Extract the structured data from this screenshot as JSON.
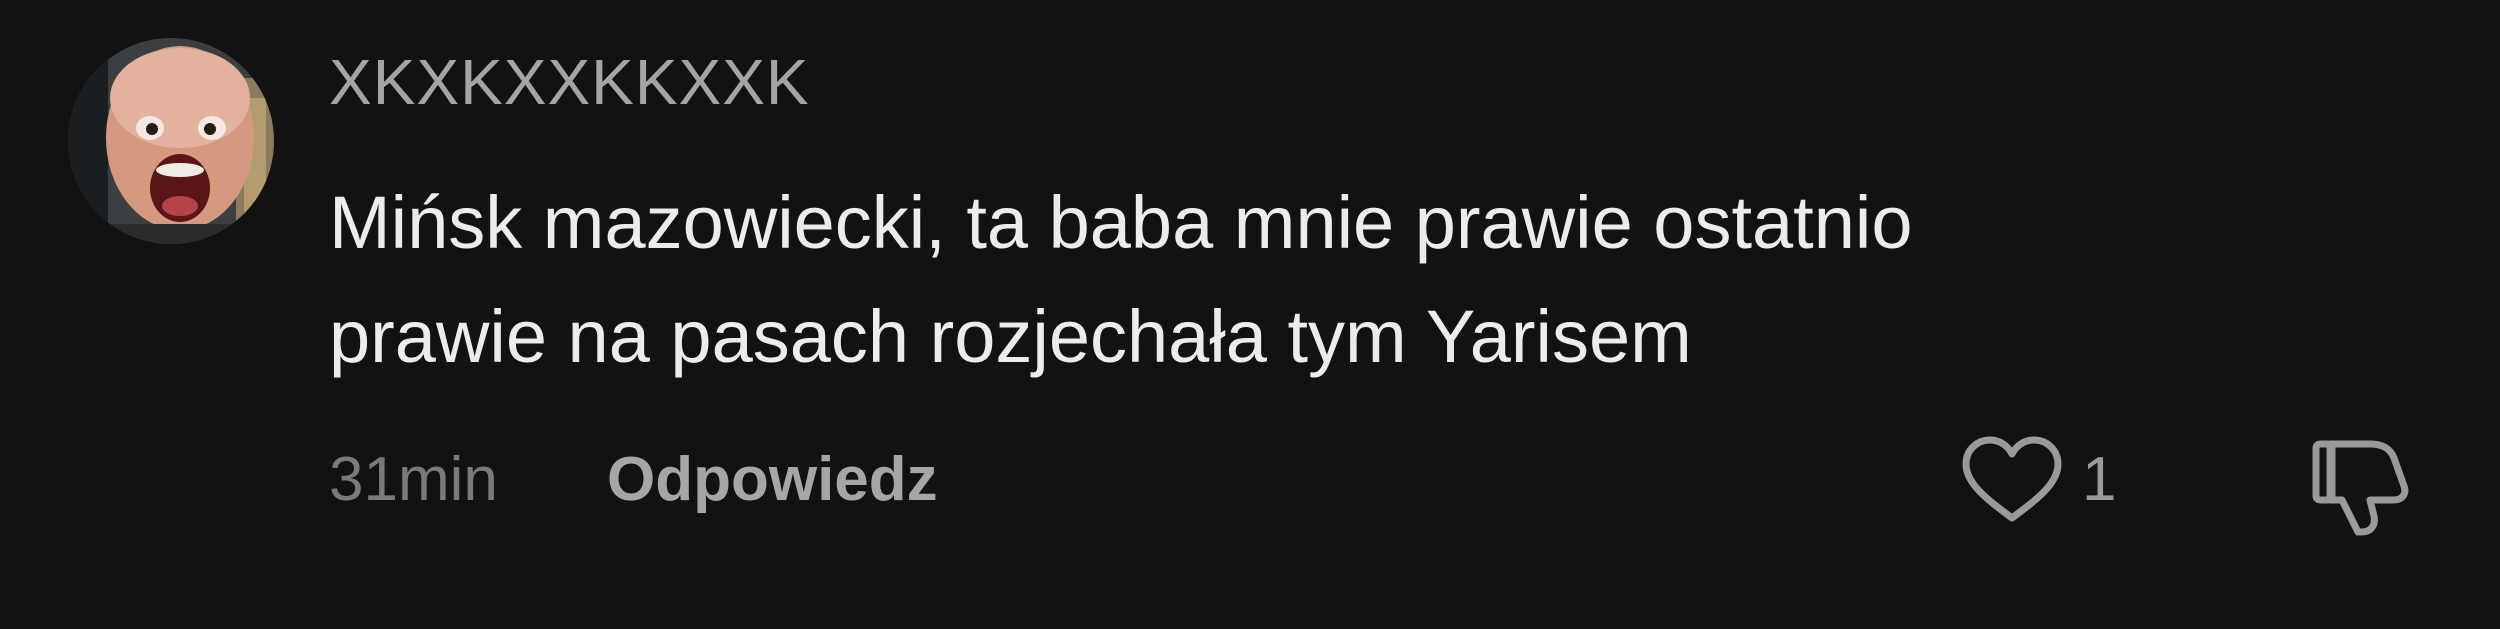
{
  "comment": {
    "username": "XKXKXXKKXXK",
    "body_lines": [
      "Mińsk mazowiecki, ta baba mnie prawie ostatnio",
      "prawie na pasach rozjechała tym Yarisem"
    ],
    "timestamp": "31min",
    "reply_label": "Odpowiedz",
    "like_count": "1",
    "icons": {
      "avatar": "user-avatar-photo",
      "like": "heart-outline-icon",
      "dislike": "thumbs-down-outline-icon"
    },
    "colors": {
      "background": "#121212",
      "username": "#a4a4a4",
      "body": "#ececec",
      "meta": "#7a7a7a",
      "reply": "#a6a6a6"
    }
  }
}
